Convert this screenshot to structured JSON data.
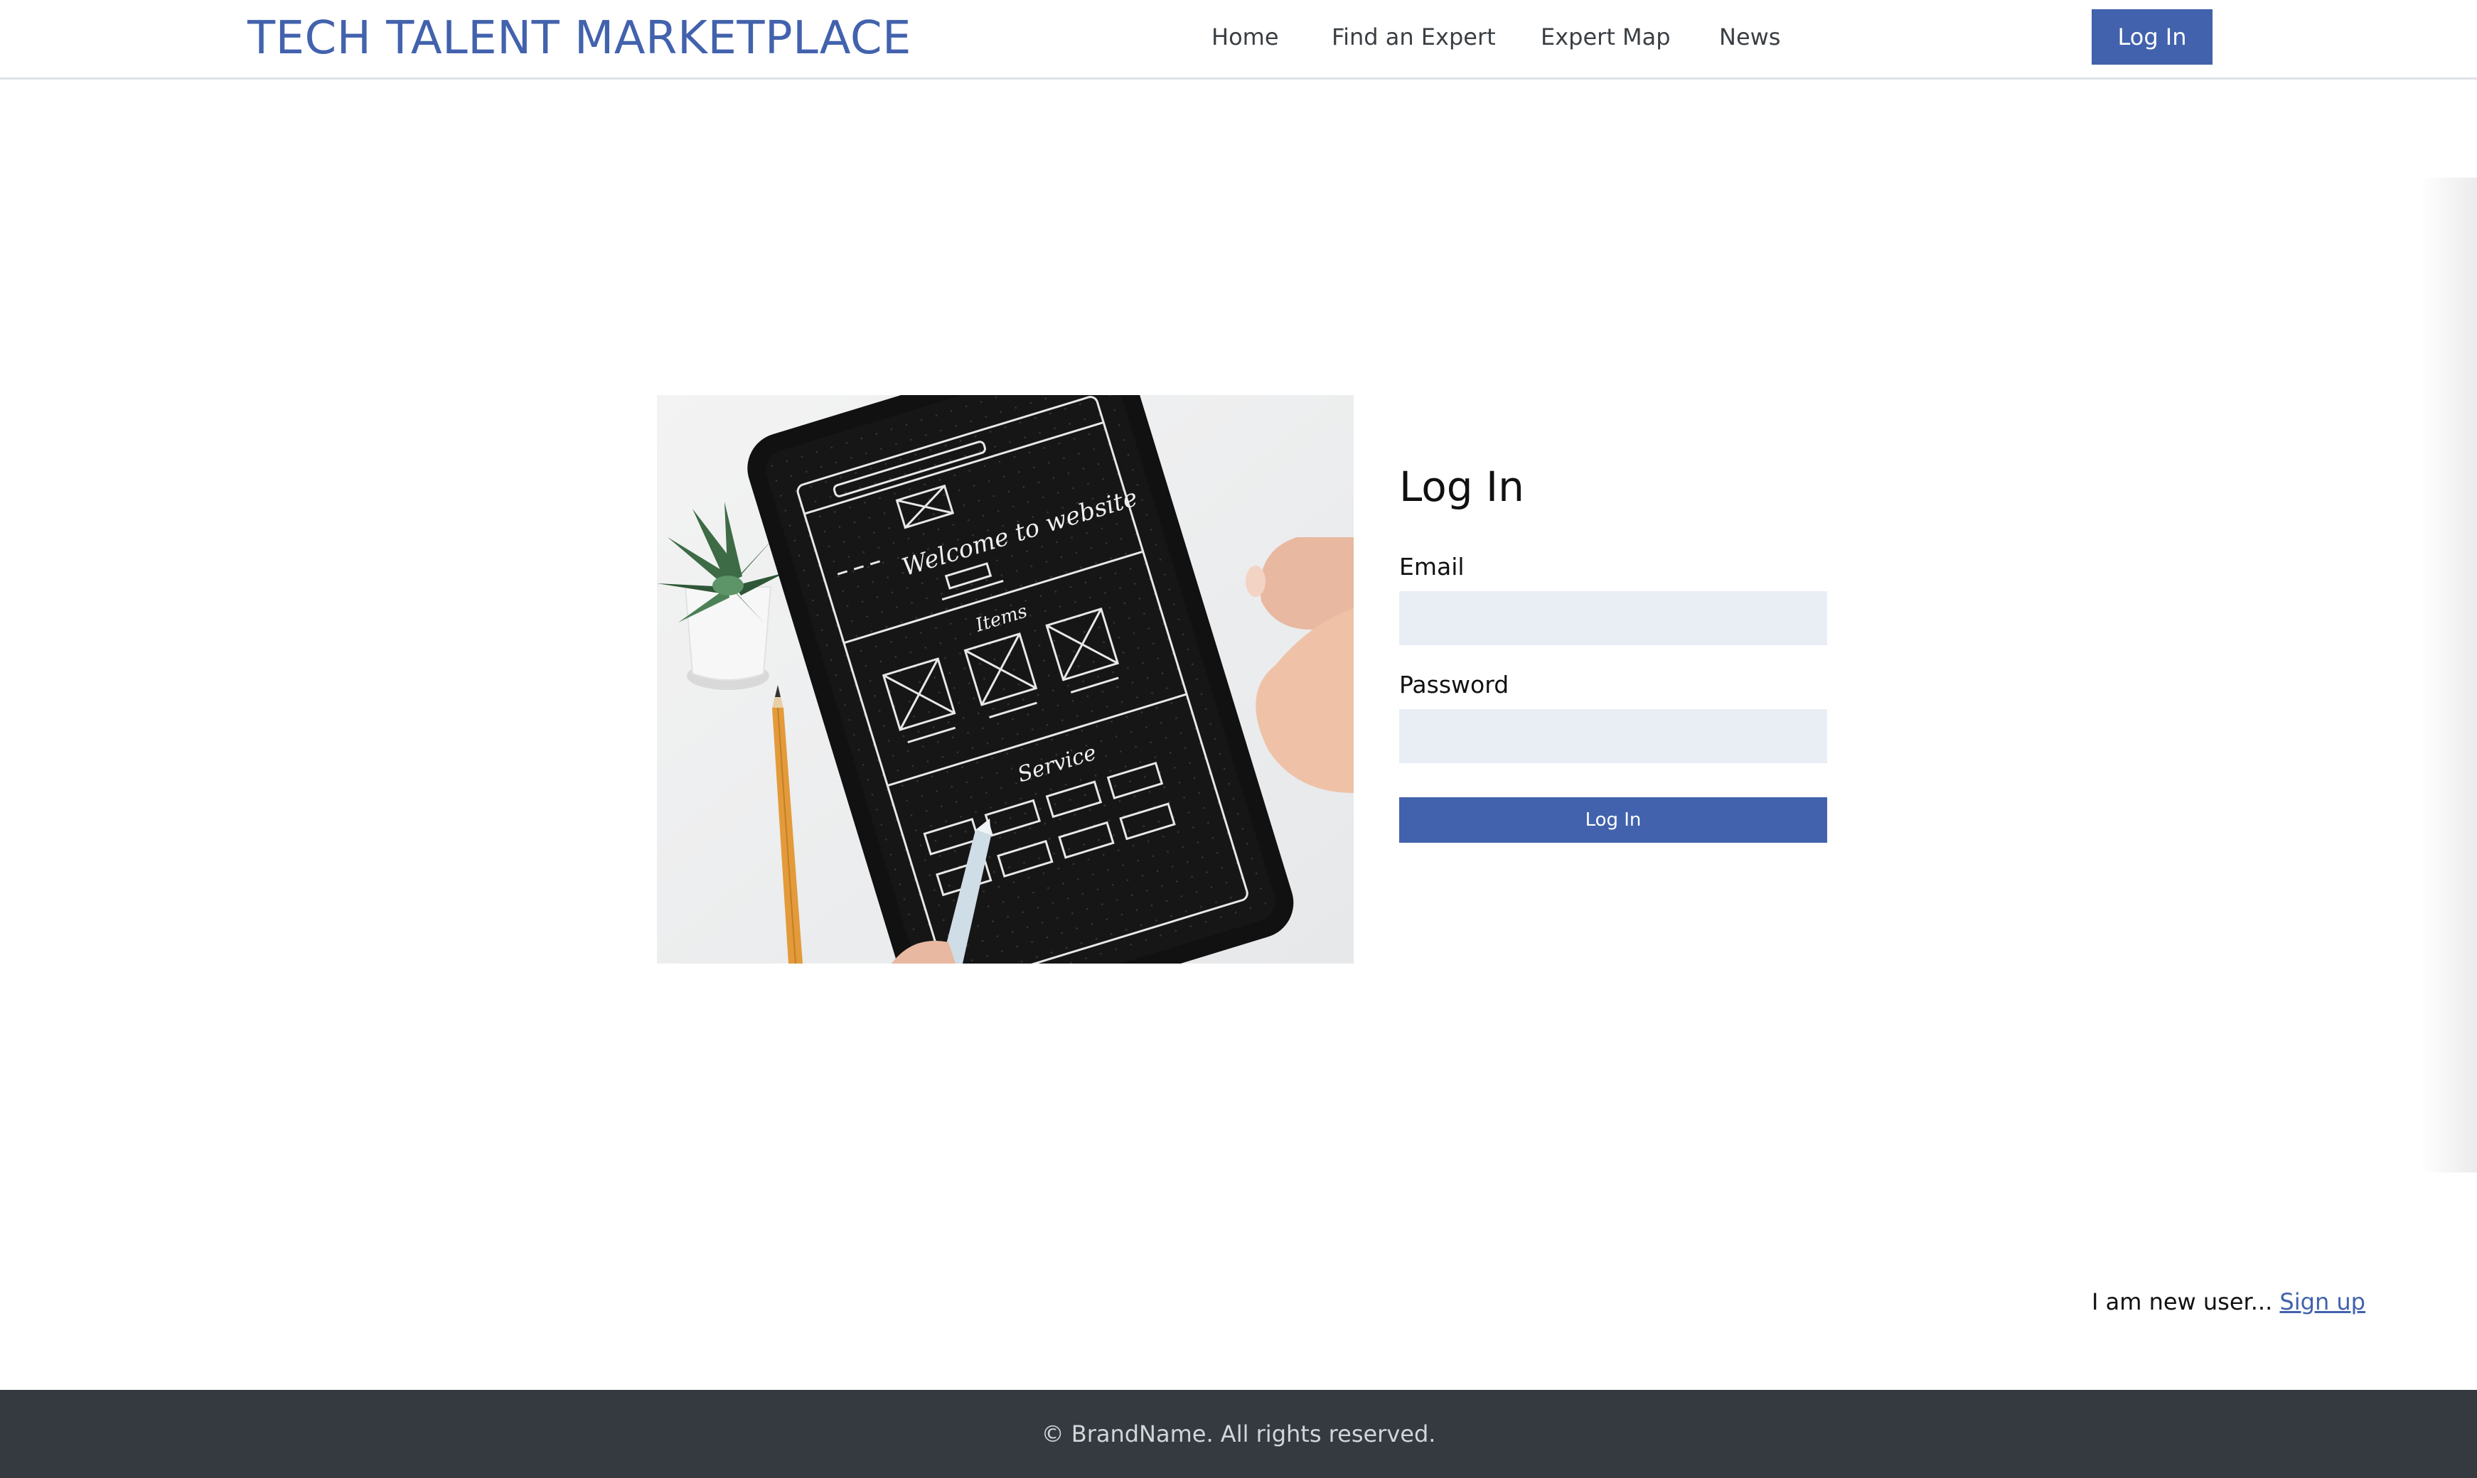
{
  "header": {
    "brand": "TECH TALENT MARKETPLACE",
    "nav": [
      {
        "label": "Home"
      },
      {
        "label": "Find an Expert"
      },
      {
        "label": "Expert Map"
      },
      {
        "label": "News"
      }
    ],
    "login_button": "Log In"
  },
  "hero_image": {
    "description_icon": "tablet-wireframe-photo",
    "handwriting": [
      "Welcome to website",
      "Items",
      "Service"
    ]
  },
  "login": {
    "title": "Log In",
    "email_label": "Email",
    "email_value": "",
    "password_label": "Password",
    "password_value": "",
    "submit_label": "Log In"
  },
  "signup": {
    "prompt": "I am new user... ",
    "link": "Sign up"
  },
  "footer": {
    "text": "© BrandName. All rights reserved."
  },
  "colors": {
    "brand": "#4262ad",
    "input_bg": "#e9eef5",
    "footer_bg": "#343a40"
  }
}
